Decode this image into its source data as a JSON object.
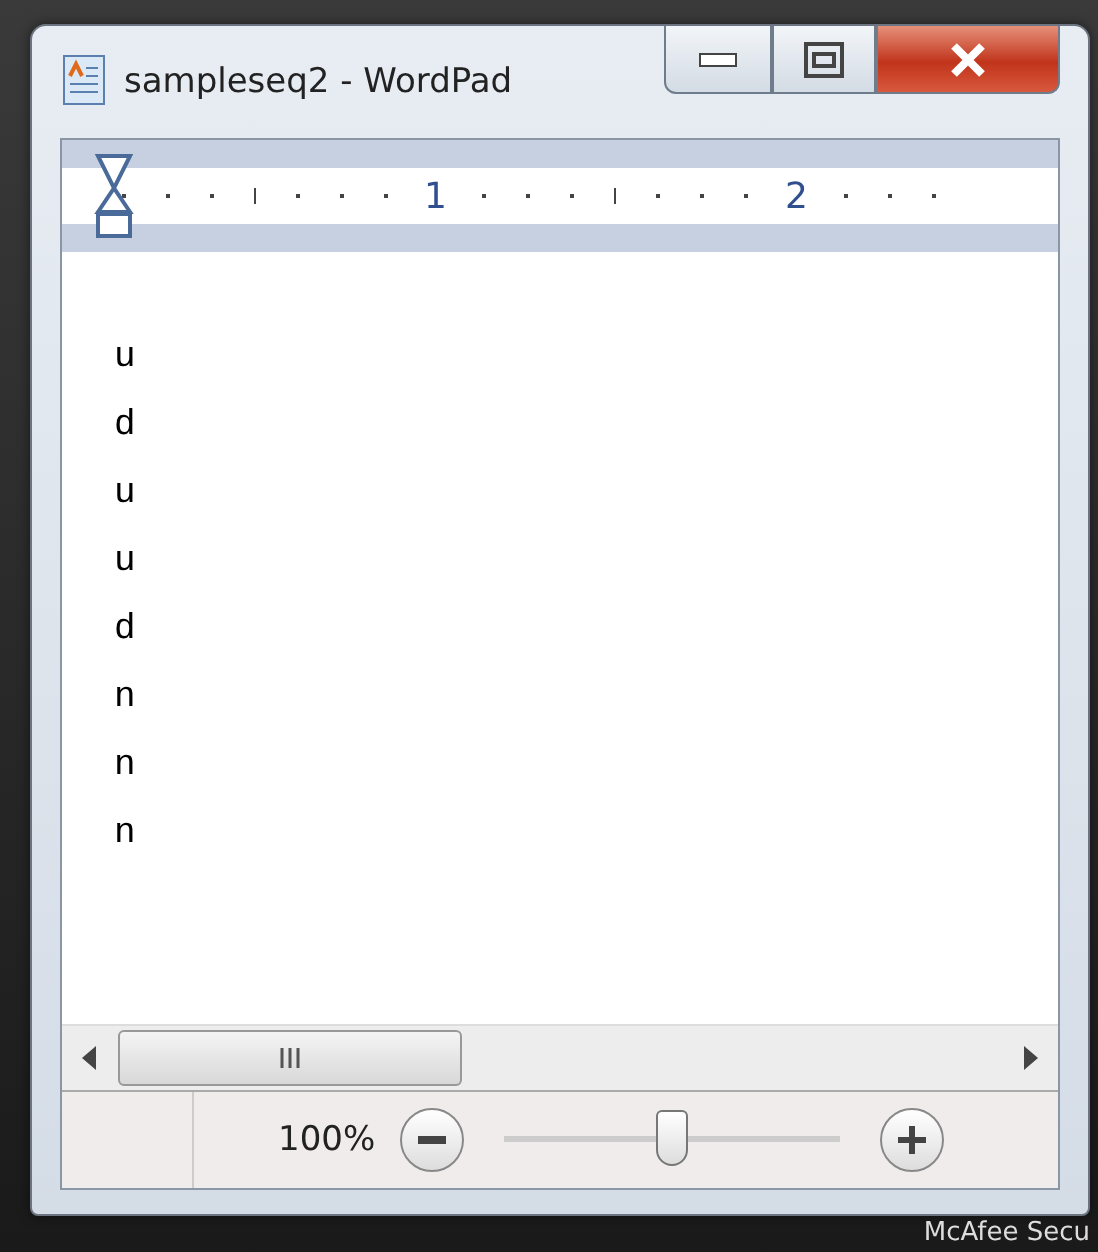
{
  "window": {
    "title": "sampleseq2 - WordPad"
  },
  "ruler": {
    "labels": [
      "1",
      "2"
    ]
  },
  "document": {
    "lines": [
      "u",
      "d",
      "u",
      "u",
      "d",
      "n",
      "n",
      "n"
    ]
  },
  "status_bar": {
    "zoom": "100%",
    "zoom_slider": {
      "level": 0.5
    }
  },
  "desktop": {
    "taskbar_item": "McAfee Secu"
  }
}
